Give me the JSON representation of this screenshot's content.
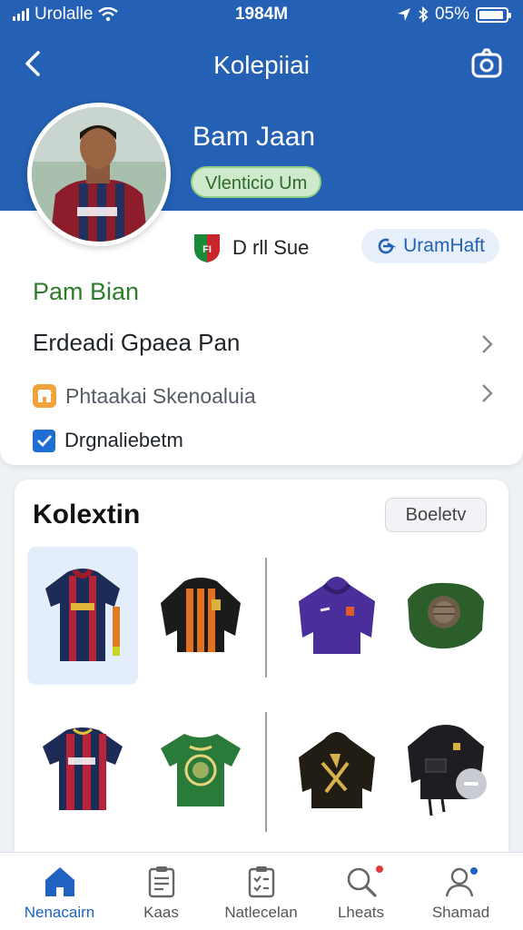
{
  "status_bar": {
    "carrier": "Urolalle",
    "time": "1984M",
    "battery": "05%"
  },
  "header": {
    "title": "Kolepiiai"
  },
  "profile": {
    "name": "Bam Jaan",
    "badge": "Vlenticio Um",
    "club_name": "D rll Sue",
    "follow_label": "UramHaft",
    "section_label": "Pam Bian",
    "row1_label": "Erdeadi Gpaea Pan",
    "row2_label": "Phtaakai Skenoaluia",
    "row3_label": "Drgnaliebetm"
  },
  "collection": {
    "title": "Kolextin",
    "button_label": "Boeletv",
    "items": [
      {
        "name": "red-navy-striped-jersey",
        "selected": true
      },
      {
        "name": "orange-black-jacket"
      },
      {
        "name": "purple-hoodie"
      },
      {
        "name": "green-helmet-pouch"
      },
      {
        "name": "red-navy-jersey"
      },
      {
        "name": "green-tshirt"
      },
      {
        "name": "black-gold-hoodie"
      },
      {
        "name": "black-jacket"
      }
    ]
  },
  "bottom_nav": [
    {
      "label": "Nenacairn",
      "icon": "home-icon",
      "active": true
    },
    {
      "label": "Kaas",
      "icon": "clipboard-icon"
    },
    {
      "label": "Natlecelan",
      "icon": "checklist-icon"
    },
    {
      "label": "Lheats",
      "icon": "search-icon"
    },
    {
      "label": "Shamad",
      "icon": "user-icon"
    }
  ],
  "colors": {
    "header_blue": "#2460b4",
    "accent_blue": "#1f62c0",
    "green": "#2f7d2a",
    "badge_green_bg": "#cfe9cc"
  }
}
